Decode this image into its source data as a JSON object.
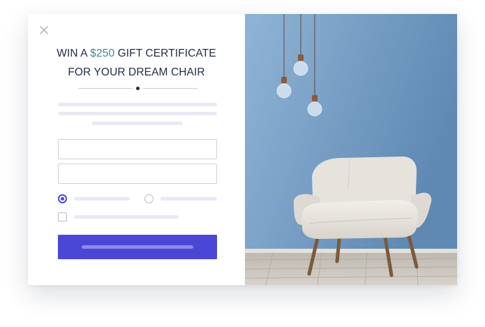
{
  "modal": {
    "close_icon": "close-icon",
    "title": {
      "line1_prefix": "WIN A ",
      "amount": "$250",
      "line1_suffix": " GIFT CERTIFICATE",
      "line2": "FOR YOUR DREAM CHAIR"
    },
    "form": {
      "radio_options": [
        {
          "selected": true
        },
        {
          "selected": false
        }
      ],
      "checkbox_checked": false,
      "submit_icon": "submit-button"
    },
    "image": {
      "subject": "armchair-with-hanging-bulbs",
      "wall_color": "#7aa3c8",
      "floor_color": "#c9c3b9"
    },
    "colors": {
      "accent": "#4b47d6",
      "amount": "#3d8a92",
      "title_text": "#1f2a44",
      "placeholder": "#e9e9f5"
    }
  }
}
